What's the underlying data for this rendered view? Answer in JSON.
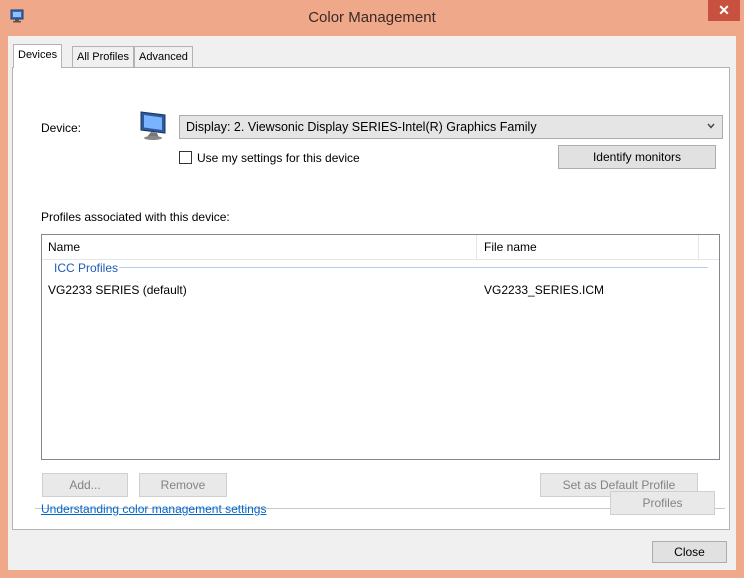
{
  "window": {
    "title": "Color Management",
    "close_glyph": "✕"
  },
  "tabs": [
    {
      "label": "Devices",
      "active": true
    },
    {
      "label": "All Profiles",
      "active": false
    },
    {
      "label": "Advanced",
      "active": false
    }
  ],
  "devices": {
    "device_label": "Device:",
    "device_value": "Display: 2. Viewsonic Display SERIES-Intel(R) Graphics Family",
    "use_my_settings_label": "Use my settings for this device",
    "use_my_settings_checked": false,
    "identify_button": "Identify monitors",
    "profiles_heading": "Profiles associated with this device:",
    "columns": [
      "Name",
      "File name"
    ],
    "group_label": "ICC Profiles",
    "rows": [
      {
        "name": "VG2233 SERIES (default)",
        "file": "VG2233_SERIES.ICM"
      }
    ],
    "add_button": "Add...",
    "remove_button": "Remove",
    "set_default_button": "Set as Default Profile",
    "help_link": "Understanding color management settings",
    "profiles_button": "Profiles"
  },
  "footer": {
    "close_button": "Close"
  },
  "icons": {
    "app": "monitor-icon",
    "device": "monitor-icon",
    "combo": "chevron-down-icon"
  },
  "colors": {
    "titlebar": "#f0a88a",
    "close": "#c7503e",
    "link": "#0066cc",
    "group": "#1e5bb6"
  }
}
